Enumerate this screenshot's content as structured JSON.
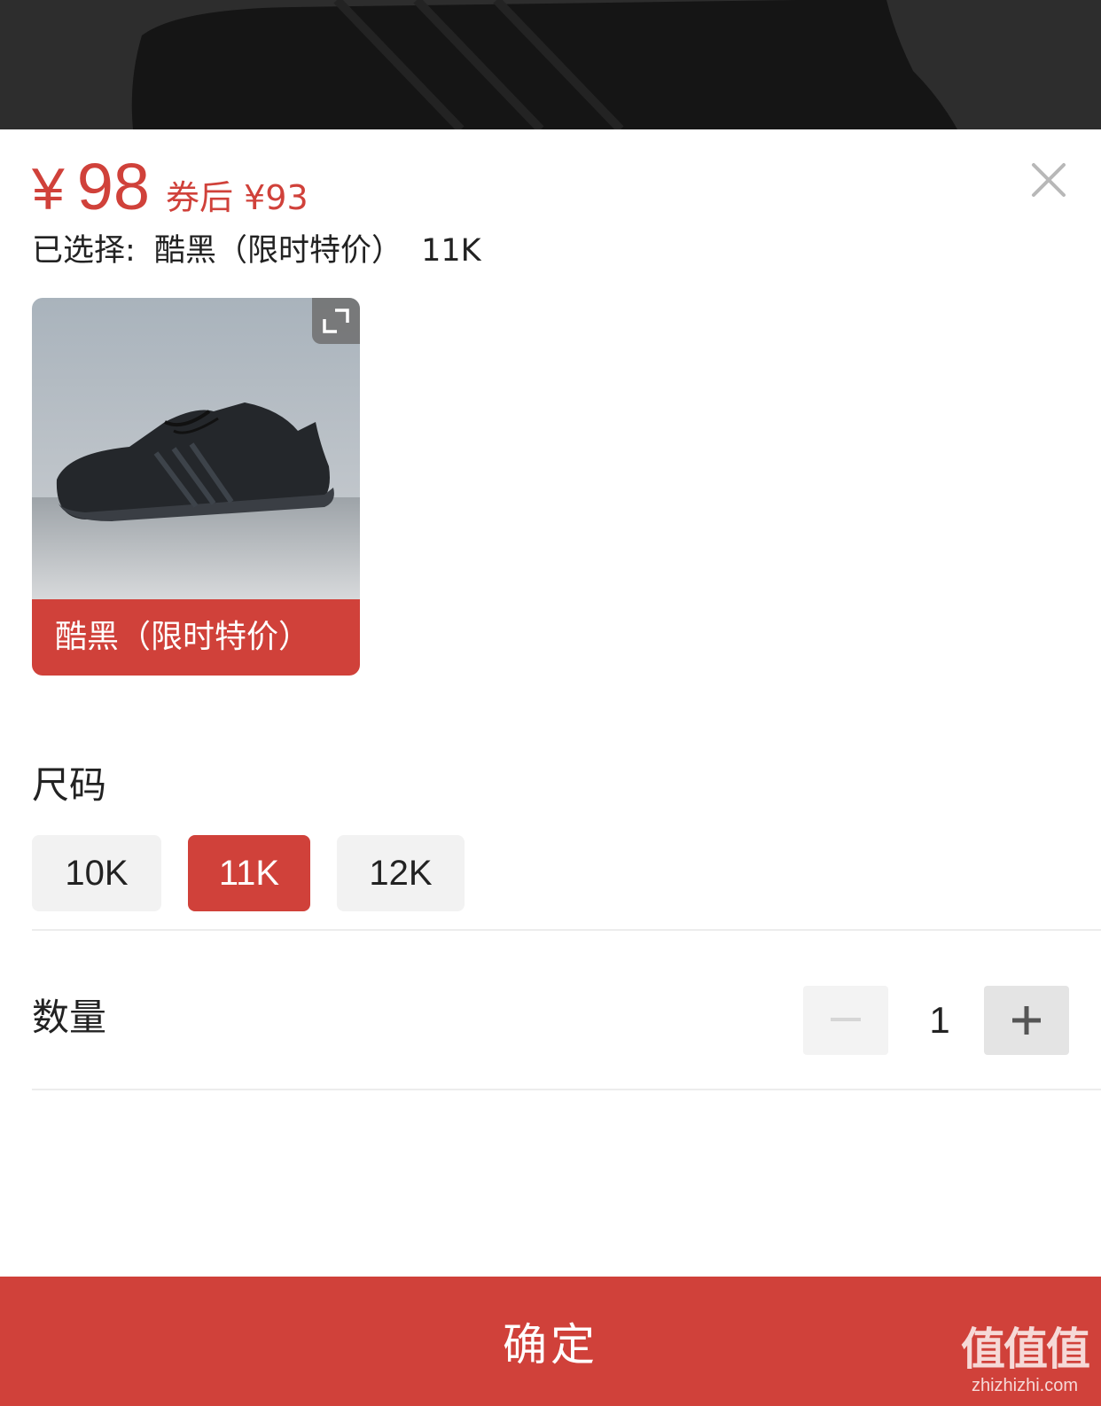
{
  "price": {
    "currency": "¥",
    "amount": "98",
    "coupon_text": "券后 ¥93"
  },
  "selection": {
    "label": "已选择:",
    "color": "酷黑（限时特价）",
    "size": "11K"
  },
  "variants": [
    {
      "label": "酷黑（限时特价）",
      "selected": true
    }
  ],
  "size_section": {
    "title": "尺码",
    "options": [
      {
        "label": "10K",
        "selected": false
      },
      {
        "label": "11K",
        "selected": true
      },
      {
        "label": "12K",
        "selected": false
      }
    ]
  },
  "quantity_section": {
    "title": "数量",
    "value": "1",
    "minus_label": "−",
    "plus_label": "+"
  },
  "confirm_button": {
    "label": "确定"
  },
  "watermark": {
    "mark": "值值值",
    "url": "zhizhizhi.com"
  },
  "icons": {
    "close": "close-icon",
    "expand": "expand-icon",
    "minus": "minus-icon",
    "plus": "plus-icon"
  },
  "colors": {
    "accent": "#d0413a",
    "chip_bg": "#f2f2f2",
    "overlay": "#2b2b2b"
  }
}
